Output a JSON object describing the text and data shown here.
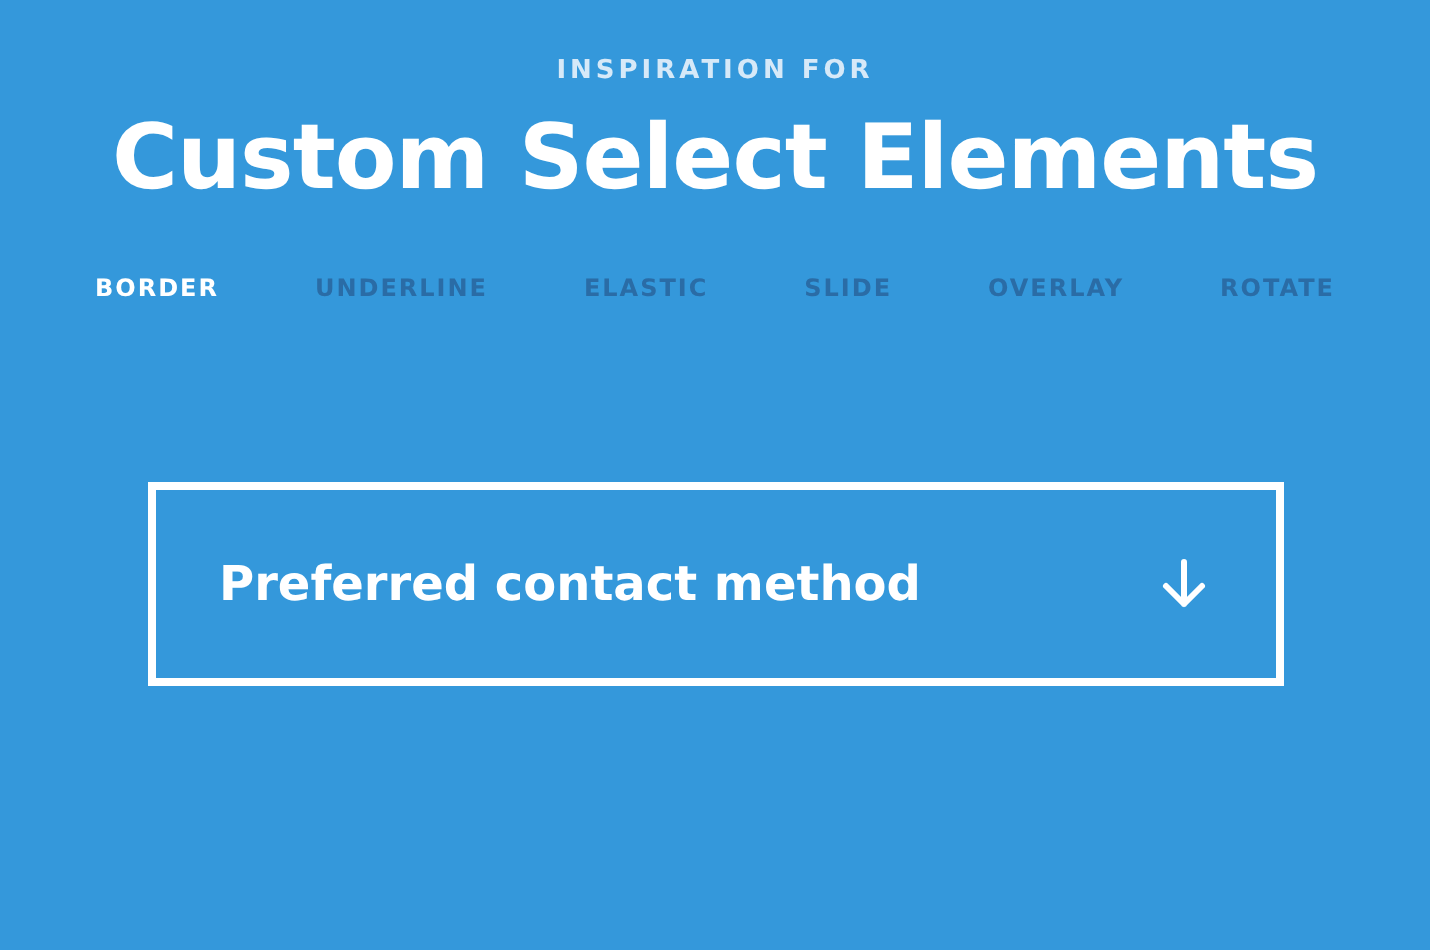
{
  "header": {
    "kicker": "INSPIRATION FOR",
    "title": "Custom Select Elements"
  },
  "tabs": [
    {
      "label": "BORDER",
      "selected": true
    },
    {
      "label": "UNDERLINE",
      "selected": false
    },
    {
      "label": "ELASTIC",
      "selected": false
    },
    {
      "label": "SLIDE",
      "selected": false
    },
    {
      "label": "OVERLAY",
      "selected": false
    },
    {
      "label": "ROTATE",
      "selected": false
    }
  ],
  "select": {
    "placeholder": "Preferred contact method"
  }
}
